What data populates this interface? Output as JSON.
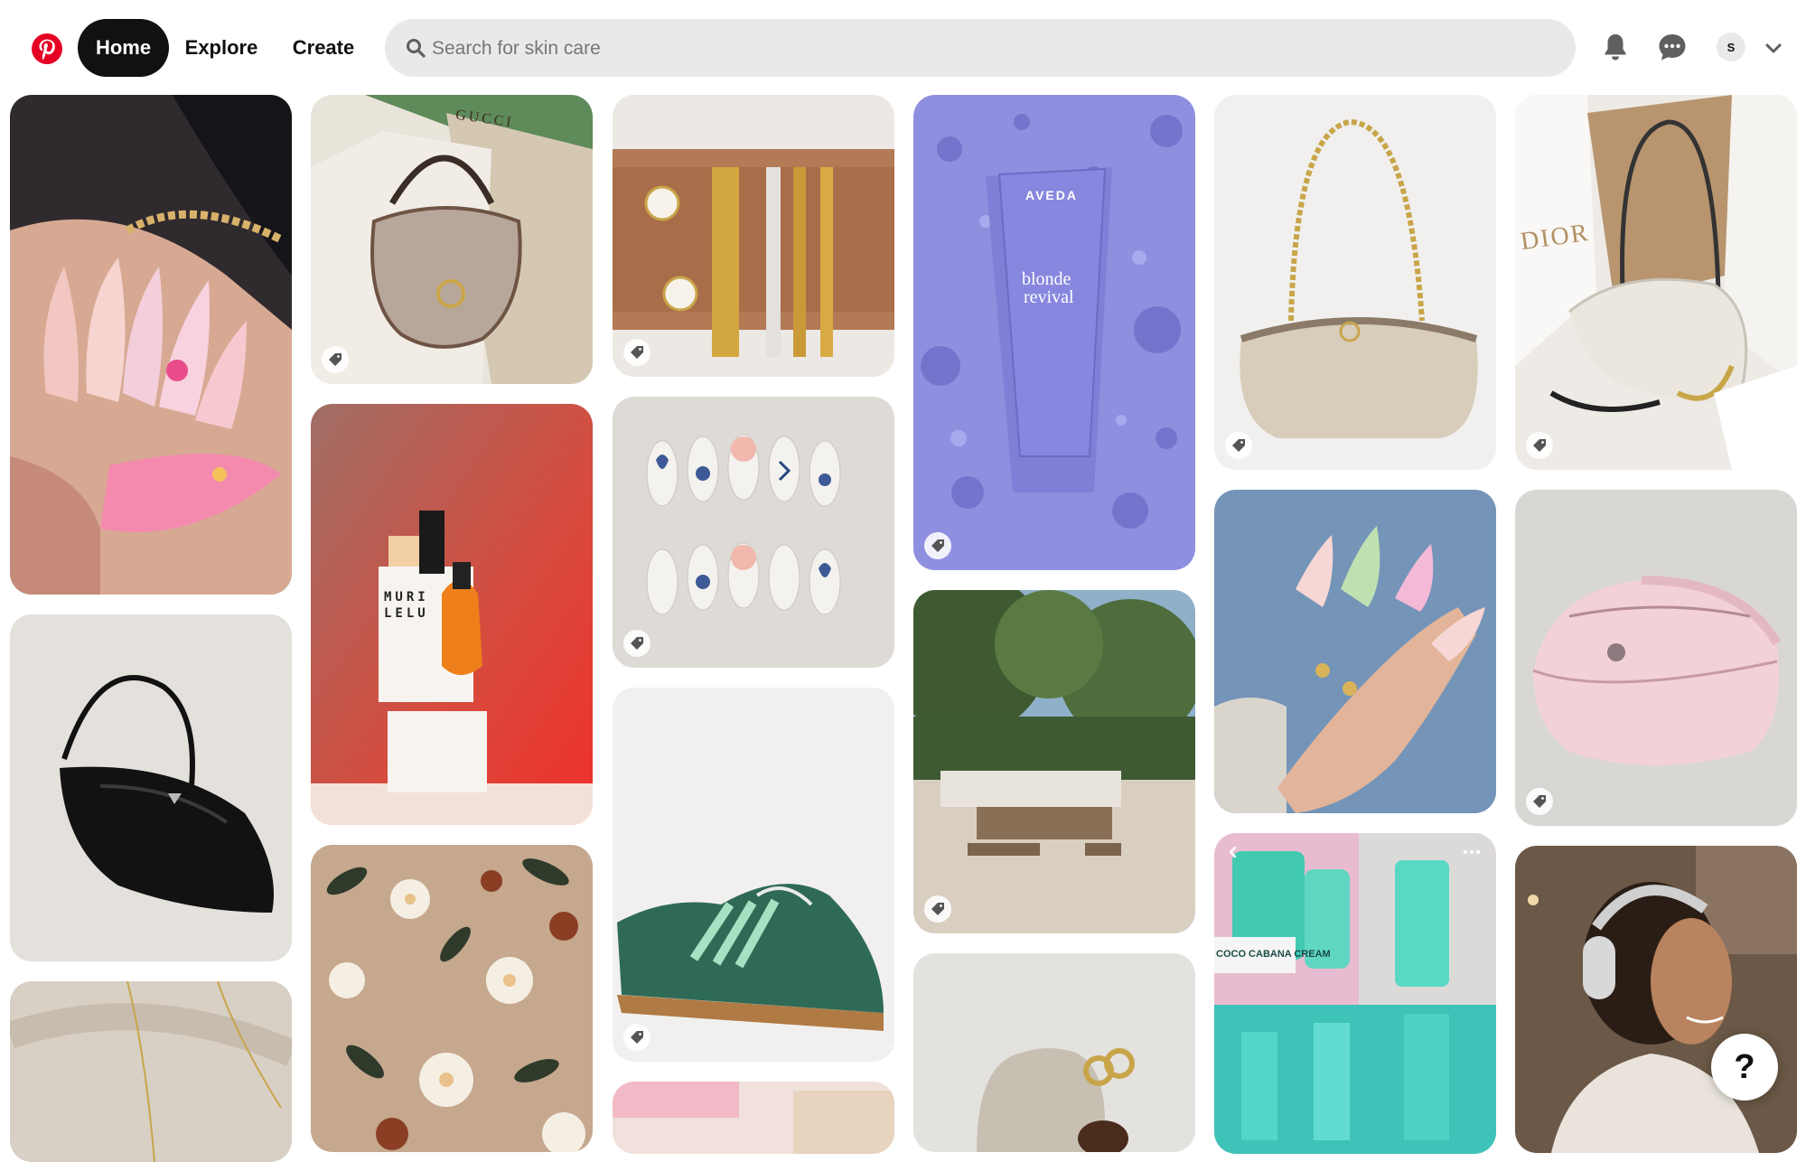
{
  "nav": {
    "home": "Home",
    "explore": "Explore",
    "create": "Create"
  },
  "search": {
    "placeholder": "Search for skin care"
  },
  "profile": {
    "initial": "S"
  },
  "pins": {
    "gucci_box": {
      "brand": "GUCCI"
    },
    "aveda": {
      "brand": "AVEDA",
      "product_line1": "blonde",
      "product_line2": "revival"
    },
    "dior": {
      "brand": "DIOR"
    },
    "muri_lelu": {
      "brand_line1": "MURI",
      "brand_line2": "LELU"
    },
    "soap": {
      "brand": "COCO CABANA CREAM"
    }
  },
  "help": {
    "label": "?"
  },
  "icons": {
    "logo": "pinterest-logo-icon",
    "search": "search-icon",
    "bell": "bell-icon",
    "chat": "chat-icon",
    "chevron": "chevron-down-icon",
    "tag": "shopping-tag-icon"
  },
  "colors": {
    "brand_red": "#e60023",
    "nav_active_bg": "#111111",
    "search_bg": "#e9e9e9"
  }
}
